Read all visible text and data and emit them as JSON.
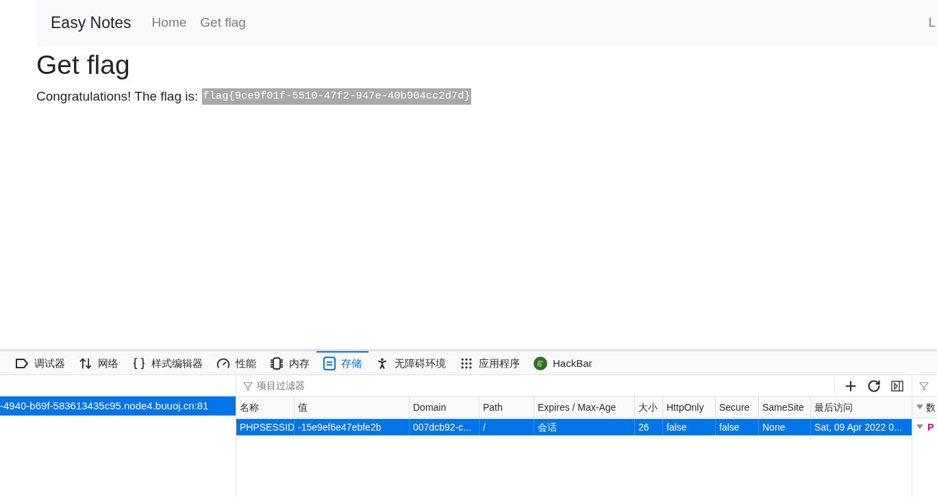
{
  "navbar": {
    "brand": "Easy Notes",
    "links": [
      {
        "label": "Home"
      },
      {
        "label": "Get flag"
      }
    ],
    "right_link": "L"
  },
  "content": {
    "heading": "Get flag",
    "message": "Congratulations! The flag is:",
    "flag": "flag{9ce9f01f-5510-47f2-947e-40b904cc2d7d}"
  },
  "devtools": {
    "tabs": [
      {
        "kind": "debugger",
        "label": "调试器",
        "selected": false
      },
      {
        "kind": "network",
        "label": "网络",
        "selected": false
      },
      {
        "kind": "style",
        "label": "样式编辑器",
        "selected": false
      },
      {
        "kind": "performance",
        "label": "性能",
        "selected": false
      },
      {
        "kind": "memory",
        "label": "内存",
        "selected": false
      },
      {
        "kind": "storage",
        "label": "存储",
        "selected": true
      },
      {
        "kind": "accessibility",
        "label": "无障碍环境",
        "selected": false
      },
      {
        "kind": "apps",
        "label": "应用程序",
        "selected": false
      },
      {
        "kind": "hackbar",
        "label": "HackBar",
        "selected": false
      }
    ],
    "hosts": [
      {
        "label": "-4940-b69f-583613435c95.node4.buuoj.cn:81",
        "selected": true
      }
    ],
    "filter": {
      "placeholder": "项目过滤器"
    },
    "table": {
      "columns": [
        "名称",
        "值",
        "Domain",
        "Path",
        "Expires / Max-Age",
        "大小",
        "HttpOnly",
        "Secure",
        "SameSite",
        "最后访问"
      ],
      "rows": [
        {
          "selected": true,
          "cells": [
            "PHPSESSID",
            "-15e9ef6e47ebfe2b",
            "007dcb92-c...",
            "/",
            "会话",
            "26",
            "false",
            "false",
            "None",
            "Sat, 09 Apr 2022 0..."
          ]
        }
      ]
    },
    "sidebar": {
      "header": {
        "label": "数",
        "expanded": true
      },
      "items": [
        {
          "label": "P",
          "expanded": true
        }
      ]
    }
  }
}
